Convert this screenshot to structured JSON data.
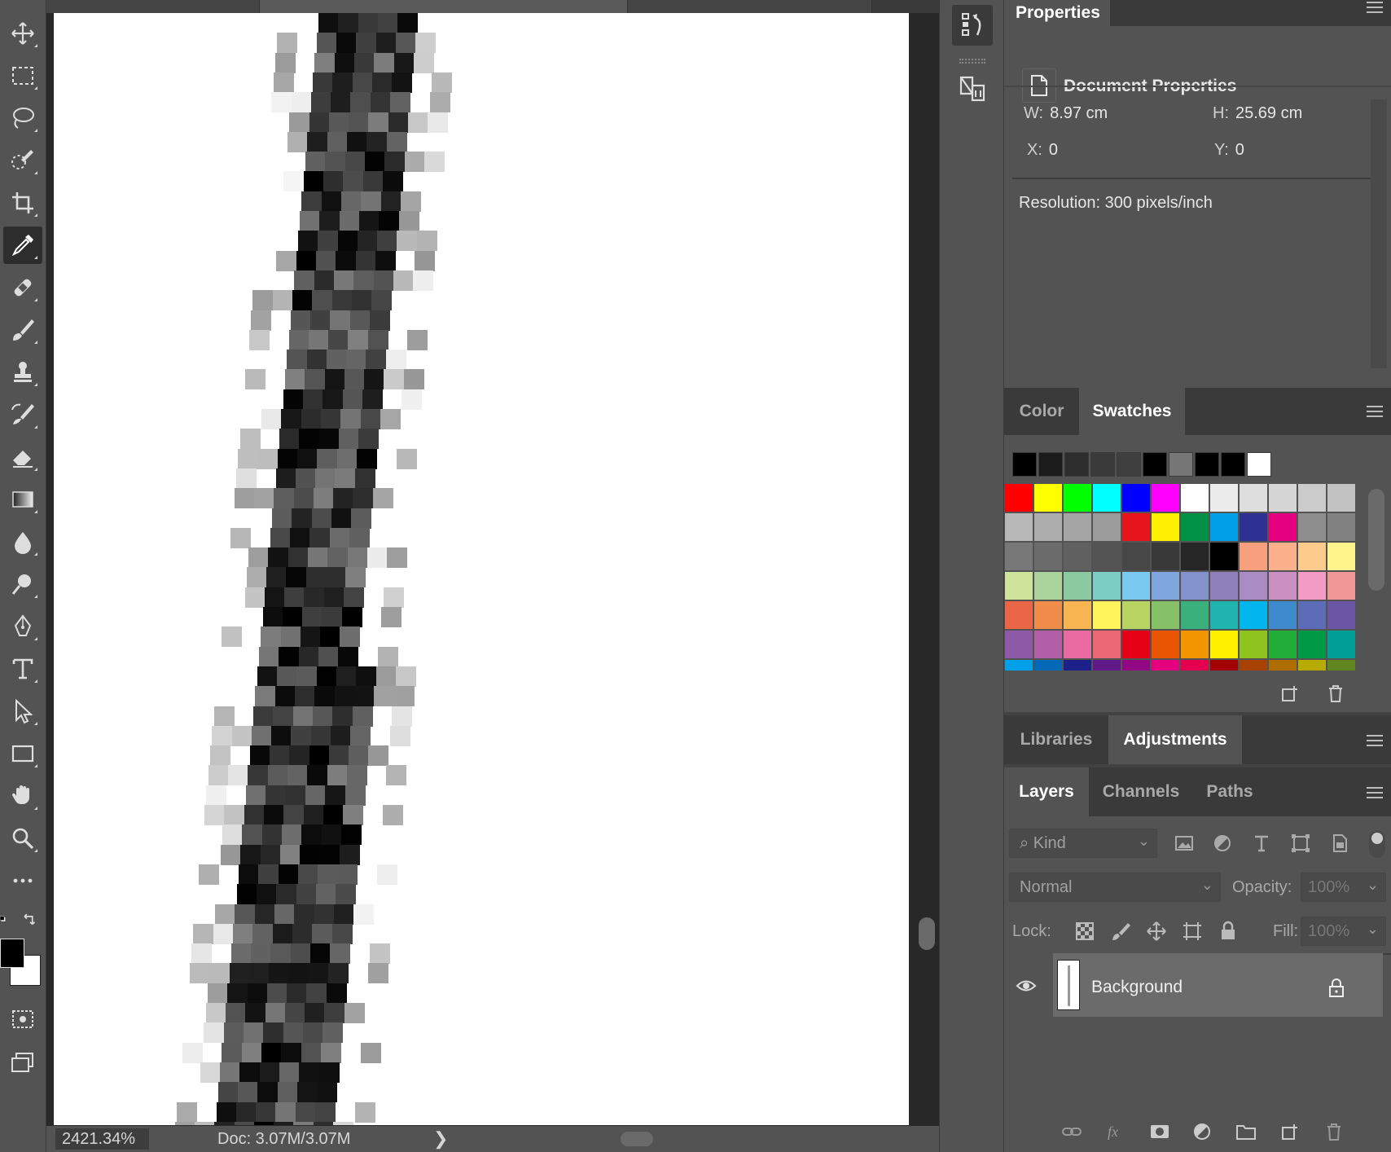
{
  "status": {
    "zoom": "2421.34%",
    "doc": "Doc: 3.07M/3.07M",
    "arrow": "❯"
  },
  "tools": [
    {
      "name": "move-tool",
      "icon": "move-icon"
    },
    {
      "name": "marquee-tool",
      "icon": "rect-marquee-icon"
    },
    {
      "name": "lasso-tool",
      "icon": "lasso-icon"
    },
    {
      "name": "quick-select-tool",
      "icon": "quick-select-icon"
    },
    {
      "name": "crop-tool",
      "icon": "crop-icon"
    },
    {
      "name": "eyedropper-tool",
      "icon": "eyedropper-icon",
      "active": true
    },
    {
      "name": "healing-brush-tool",
      "icon": "bandage-icon"
    },
    {
      "name": "brush-tool",
      "icon": "brush-icon"
    },
    {
      "name": "stamp-tool",
      "icon": "stamp-icon"
    },
    {
      "name": "history-brush-tool",
      "icon": "history-brush-icon"
    },
    {
      "name": "eraser-tool",
      "icon": "eraser-icon"
    },
    {
      "name": "gradient-tool",
      "icon": "gradient-icon"
    },
    {
      "name": "blur-tool",
      "icon": "drop-icon"
    },
    {
      "name": "dodge-tool",
      "icon": "dodge-icon"
    },
    {
      "name": "pen-tool",
      "icon": "pen-icon"
    },
    {
      "name": "type-tool",
      "icon": "type-icon"
    },
    {
      "name": "path-select-tool",
      "icon": "arrow-icon"
    },
    {
      "name": "rectangle-tool",
      "icon": "rectangle-icon"
    },
    {
      "name": "hand-tool",
      "icon": "hand-icon"
    },
    {
      "name": "zoom-tool",
      "icon": "magnifier-icon"
    },
    {
      "name": "more-tools",
      "icon": "ellipsis-icon"
    }
  ],
  "properties": {
    "tab": "Properties",
    "title": "Document Properties",
    "w_label": "W:",
    "w": "8.97 cm",
    "h_label": "H:",
    "h": "25.69 cm",
    "x_label": "X:",
    "x": "0",
    "y_label": "Y:",
    "y": "0",
    "resolution": "Resolution: 300 pixels/inch"
  },
  "color_tabs": {
    "color": "Color",
    "swatches": "Swatches"
  },
  "recent_swatches": [
    "#000000",
    "#1b1b1b",
    "#2d2d2d",
    "#3a3a3a",
    "#3f3f3f",
    "#000000",
    "#777777",
    "#000000",
    "#000000",
    "#ffffff"
  ],
  "swatches": [
    "#ff0000",
    "#ffff00",
    "#00ff00",
    "#00ffff",
    "#0000ff",
    "#ff00ff",
    "#ffffff",
    "#ececec",
    "#dedede",
    "#d6d6d6",
    "#cbcbcb",
    "#c2c2c2",
    "#b8b8b8",
    "#aeaeae",
    "#a5a5a5",
    "#9b9b9b",
    "#e8141c",
    "#ffef00",
    "#009144",
    "#00a0e9",
    "#2e3192",
    "#e4007f",
    "#8e8e8e",
    "#828282",
    "#787878",
    "#6c6c6c",
    "#606060",
    "#545454",
    "#474747",
    "#393939",
    "#262626",
    "#000000",
    "#f8a07e",
    "#fab08a",
    "#fdcb8b",
    "#fff48c",
    "#cfe39a",
    "#a9d39b",
    "#8cc9a0",
    "#7ccdc4",
    "#79c9f0",
    "#7fa7dd",
    "#8492cc",
    "#8f80bc",
    "#a98cc3",
    "#c98fc0",
    "#f39bc4",
    "#f19697",
    "#eb6646",
    "#f18d4a",
    "#f8b552",
    "#fff45c",
    "#b8d462",
    "#86c168",
    "#3ab07c",
    "#1fb4ad",
    "#00b6ed",
    "#3f89cd",
    "#5c6cb6",
    "#6a56a4",
    "#8e5aa7",
    "#b25fa7",
    "#ea6aa2",
    "#ec6877",
    "#e50016",
    "#ea5504",
    "#f29600",
    "#fff000",
    "#8fc31f",
    "#22ac38",
    "#009944",
    "#009e96",
    "#00a0e9",
    "#0068b7",
    "#1d2088",
    "#601986",
    "#920783",
    "#e4007f",
    "#e5004f",
    "#a40000",
    "#a84200",
    "#ad6d00",
    "#b7aa00",
    "#5f8620"
  ],
  "adjust_tabs": {
    "libraries": "Libraries",
    "adjustments": "Adjustments"
  },
  "layers_tabs": {
    "layers": "Layers",
    "channels": "Channels",
    "paths": "Paths"
  },
  "layers": {
    "kind": "Kind",
    "blend": "Normal",
    "opacity_label": "Opacity:",
    "opacity": "100%",
    "lock_label": "Lock:",
    "fill_label": "Fill:",
    "fill": "100%",
    "items": [
      {
        "name": "Background",
        "visible": true,
        "locked": true
      }
    ]
  },
  "colors": {
    "panel": "#535353",
    "tabs": "#424242",
    "selected_layer": "#6b6b6b",
    "foreground": "#000000",
    "background": "#ffffff"
  }
}
